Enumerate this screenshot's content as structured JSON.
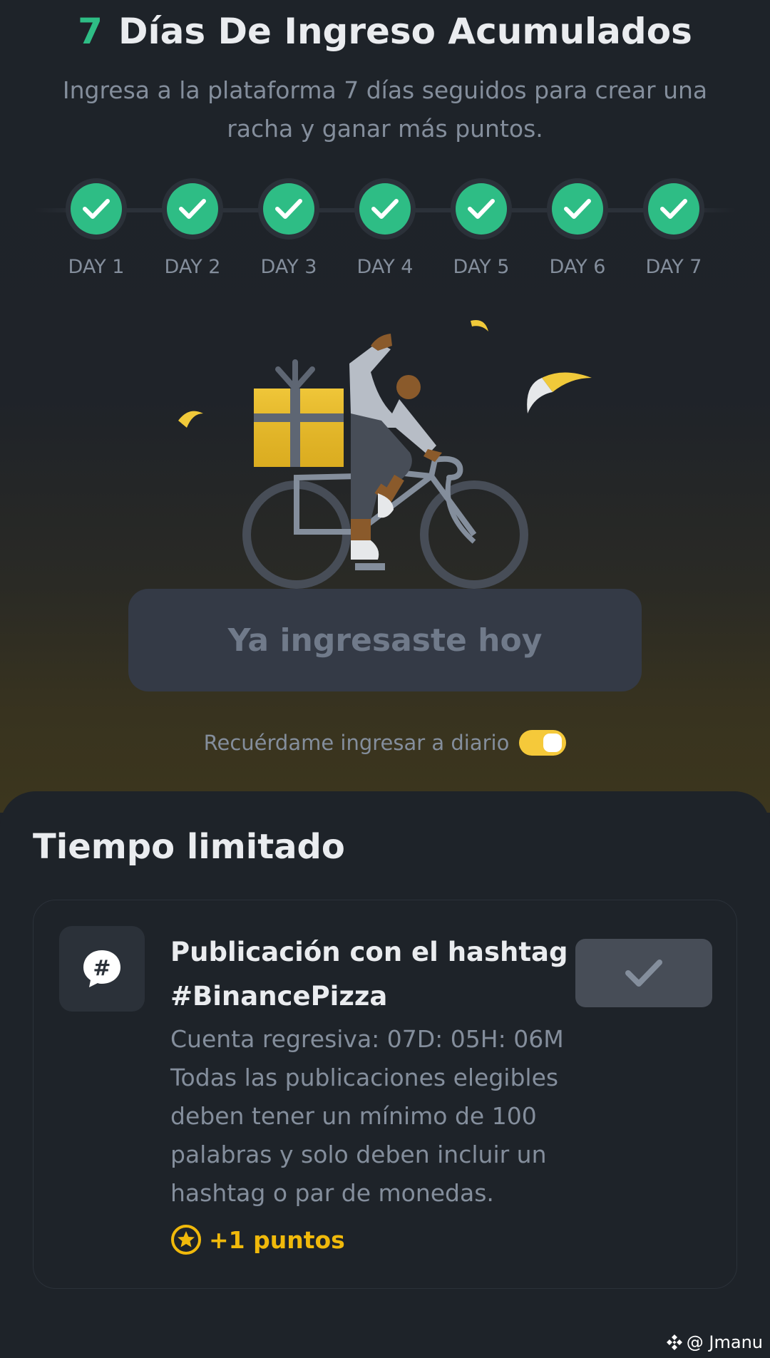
{
  "header": {
    "days_count": "7",
    "title": "Días De Ingreso Acumulados",
    "subtitle": "Ingresa a la plataforma 7 días seguidos para crear una racha y ganar más puntos."
  },
  "streak": {
    "days": [
      {
        "label": "DAY 1",
        "completed": true
      },
      {
        "label": "DAY 2",
        "completed": true
      },
      {
        "label": "DAY 3",
        "completed": true
      },
      {
        "label": "DAY 4",
        "completed": true
      },
      {
        "label": "DAY 5",
        "completed": true
      },
      {
        "label": "DAY 6",
        "completed": true
      },
      {
        "label": "DAY 7",
        "completed": true
      }
    ]
  },
  "checkin": {
    "button_label": "Ya ingresaste hoy",
    "reminder_label": "Recuérdame ingresar a diario",
    "reminder_enabled": true
  },
  "limited": {
    "section_title": "Tiempo limitado",
    "task": {
      "icon": "hashtag-chat-icon",
      "title": "Publicación con el hashtag #BinancePizza",
      "countdown": "Cuenta regresiva: 07D: 05H: 06M",
      "description": "Todas las publicaciones elegibles deben tener un mínimo de 100 palabras y solo deben incluir un hashtag o par de monedas.",
      "points": "+1 puntos",
      "status": "completed"
    }
  },
  "watermark": {
    "handle": "@ Jmanu"
  },
  "colors": {
    "accent_green": "#2ebd85",
    "accent_yellow": "#f0b90b",
    "background": "#1e2329",
    "muted_text": "#848e9c"
  }
}
